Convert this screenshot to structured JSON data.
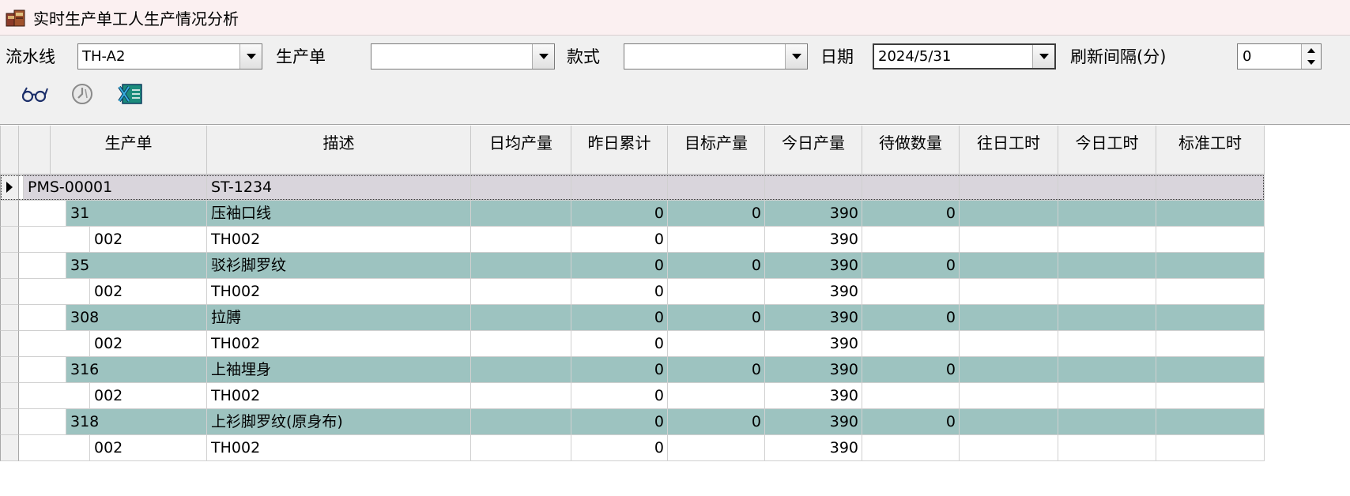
{
  "window": {
    "title": "实时生产单工人生产情况分析"
  },
  "filters": {
    "line_label": "流水线",
    "line_value": "TH-A2",
    "order_label": "生产单",
    "order_value": "",
    "style_label": "款式",
    "style_value": "",
    "date_label": "日期",
    "date_value": "2024/5/31",
    "refresh_label": "刷新间隔(分)",
    "refresh_value": "0"
  },
  "toolbar": {
    "view_icon": "glasses-icon",
    "stop_icon": "clock-icon",
    "excel_icon": "excel-export-icon"
  },
  "grid": {
    "columns": [
      "生产单",
      "描述",
      "日均产量",
      "昨日累计",
      "目标产量",
      "今日产量",
      "待做数量",
      "往日工时",
      "今日工时",
      "标准工时"
    ],
    "rows": [
      {
        "level": 0,
        "code": "PMS-00001",
        "desc": "ST-1234",
        "daily": "",
        "yesterday": "",
        "target": "",
        "today": "",
        "pending": "",
        "past_hours": "",
        "today_hours": "",
        "std_hours": ""
      },
      {
        "level": 1,
        "code": "31",
        "desc": "压袖口线",
        "daily": "",
        "yesterday": "0",
        "target": "0",
        "today": "390",
        "pending": "0",
        "past_hours": "",
        "today_hours": "",
        "std_hours": ""
      },
      {
        "level": 2,
        "code": "002",
        "desc": "TH002",
        "daily": "",
        "yesterday": "0",
        "target": "",
        "today": "390",
        "pending": "",
        "past_hours": "",
        "today_hours": "",
        "std_hours": ""
      },
      {
        "level": 1,
        "code": "35",
        "desc": "驳衫脚罗纹",
        "daily": "",
        "yesterday": "0",
        "target": "0",
        "today": "390",
        "pending": "0",
        "past_hours": "",
        "today_hours": "",
        "std_hours": ""
      },
      {
        "level": 2,
        "code": "002",
        "desc": "TH002",
        "daily": "",
        "yesterday": "0",
        "target": "",
        "today": "390",
        "pending": "",
        "past_hours": "",
        "today_hours": "",
        "std_hours": ""
      },
      {
        "level": 1,
        "code": "308",
        "desc": "拉膊",
        "daily": "",
        "yesterday": "0",
        "target": "0",
        "today": "390",
        "pending": "0",
        "past_hours": "",
        "today_hours": "",
        "std_hours": ""
      },
      {
        "level": 2,
        "code": "002",
        "desc": "TH002",
        "daily": "",
        "yesterday": "0",
        "target": "",
        "today": "390",
        "pending": "",
        "past_hours": "",
        "today_hours": "",
        "std_hours": ""
      },
      {
        "level": 1,
        "code": "316",
        "desc": "上袖埋身",
        "daily": "",
        "yesterday": "0",
        "target": "0",
        "today": "390",
        "pending": "0",
        "past_hours": "",
        "today_hours": "",
        "std_hours": ""
      },
      {
        "level": 2,
        "code": "002",
        "desc": "TH002",
        "daily": "",
        "yesterday": "0",
        "target": "",
        "today": "390",
        "pending": "",
        "past_hours": "",
        "today_hours": "",
        "std_hours": ""
      },
      {
        "level": 1,
        "code": "318",
        "desc": "上衫脚罗纹(原身布)",
        "daily": "",
        "yesterday": "0",
        "target": "0",
        "today": "390",
        "pending": "0",
        "past_hours": "",
        "today_hours": "",
        "std_hours": ""
      },
      {
        "level": 2,
        "code": "002",
        "desc": "TH002",
        "daily": "",
        "yesterday": "0",
        "target": "",
        "today": "390",
        "pending": "",
        "past_hours": "",
        "today_hours": "",
        "std_hours": ""
      }
    ]
  },
  "colors": {
    "operation_row": "#9dc3c0",
    "order_row": "#d9d5dc",
    "title_bar": "#fbf0f1"
  }
}
